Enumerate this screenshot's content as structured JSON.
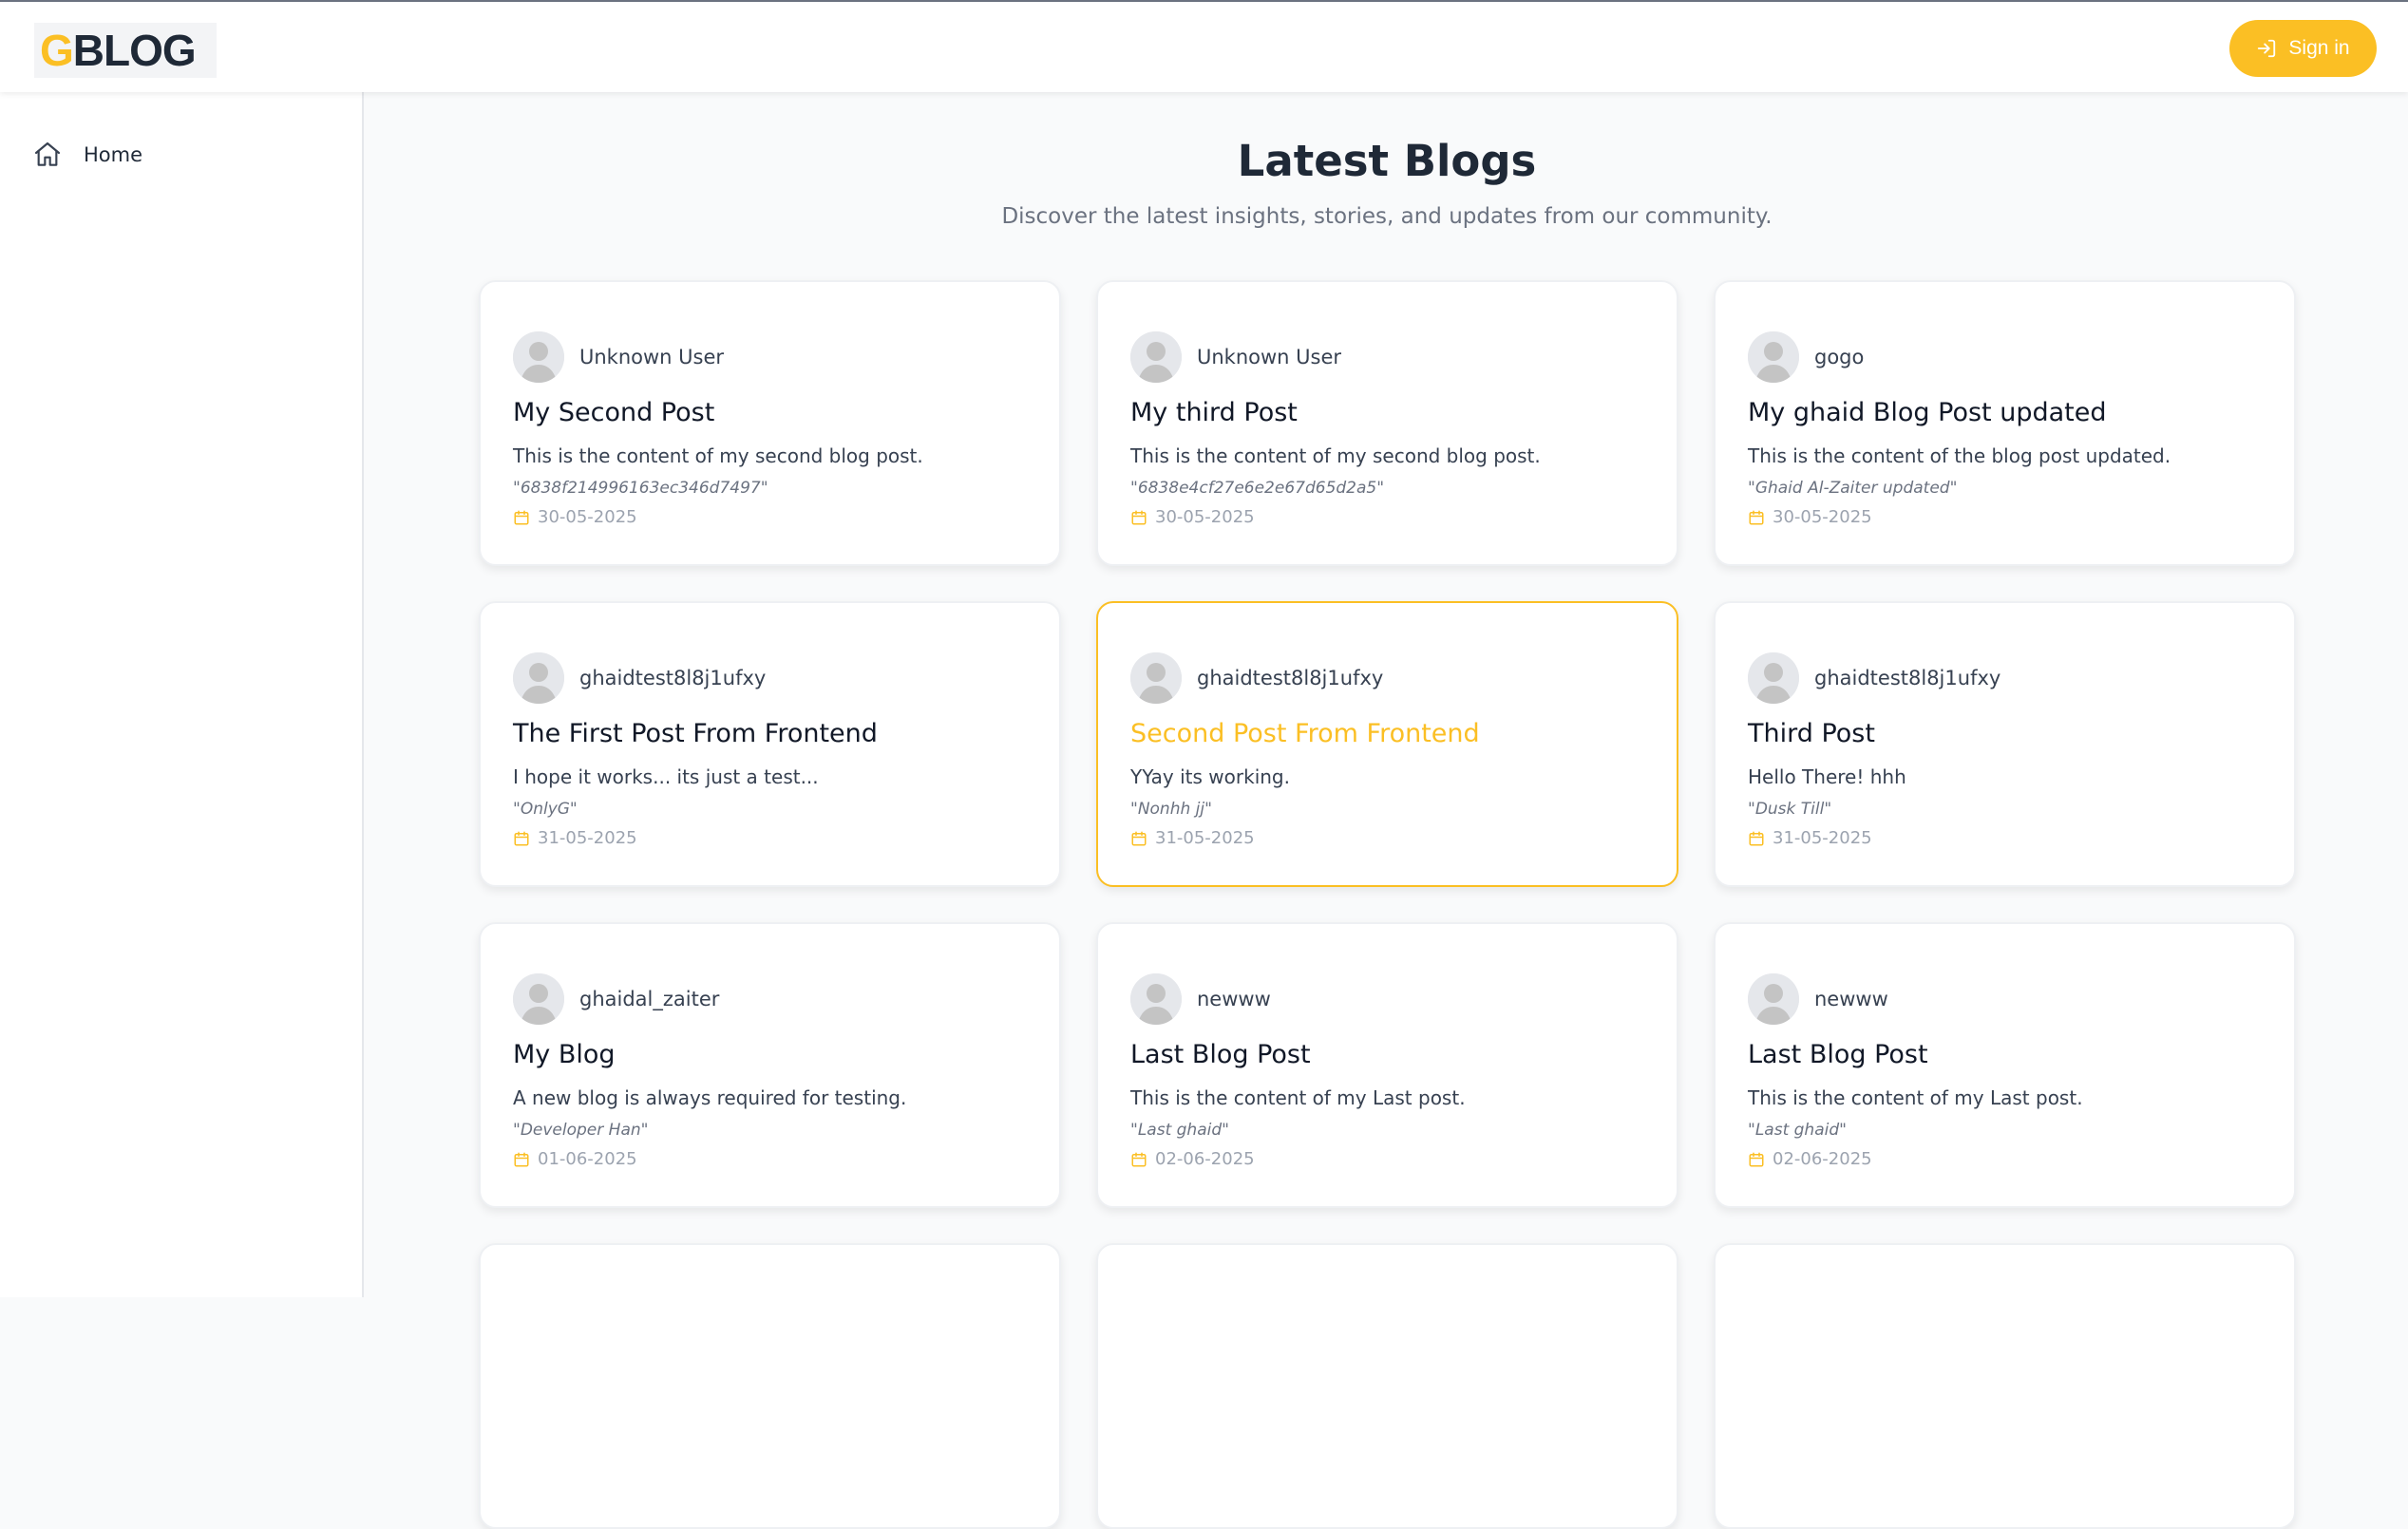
{
  "header": {
    "logo_g": "G",
    "logo_rest": "BLOG",
    "signin_label": "Sign in"
  },
  "sidebar": {
    "items": [
      {
        "label": "Home",
        "icon": "home-icon"
      }
    ]
  },
  "main": {
    "title": "Latest Blogs",
    "subtitle": "Discover the latest insights, stories, and updates from our community."
  },
  "colors": {
    "accent": "#fbbf24",
    "text": "#1f2937",
    "muted": "#6b7280"
  },
  "posts": [
    {
      "author": "Unknown User",
      "title": "My Second Post",
      "content": "This is the content of my second blog post.",
      "quote": "\"6838f214996163ec346d7497\"",
      "date": "30-05-2025"
    },
    {
      "author": "Unknown User",
      "title": "My third Post",
      "content": "This is the content of my second blog post.",
      "quote": "\"6838e4cf27e6e2e67d65d2a5\"",
      "date": "30-05-2025"
    },
    {
      "author": "gogo",
      "title": "My ghaid Blog Post updated",
      "content": "This is the content of the blog post updated.",
      "quote": "\"Ghaid Al-Zaiter updated\"",
      "date": "30-05-2025"
    },
    {
      "author": "ghaidtest8l8j1ufxy",
      "title": "The First Post From Frontend",
      "content": "I hope it works... its just a test...",
      "quote": "\"OnlyG\"",
      "date": "31-05-2025"
    },
    {
      "author": "ghaidtest8l8j1ufxy",
      "title": "Second Post From Frontend",
      "content": "YYay its working.",
      "quote": "\"Nonhh jj\"",
      "date": "31-05-2025",
      "active": true
    },
    {
      "author": "ghaidtest8l8j1ufxy",
      "title": "Third Post",
      "content": "Hello There! hhh",
      "quote": "\"Dusk Till\"",
      "date": "31-05-2025"
    },
    {
      "author": "ghaidal_zaiter",
      "title": "My Blog",
      "content": "A new blog is always required for testing.",
      "quote": "\"Developer Han\"",
      "date": "01-06-2025"
    },
    {
      "author": "newww",
      "title": "Last Blog Post",
      "content": "This is the content of my Last post.",
      "quote": "\"Last ghaid\"",
      "date": "02-06-2025"
    },
    {
      "author": "newww",
      "title": "Last Blog Post",
      "content": "This is the content of my Last post.",
      "quote": "\"Last ghaid\"",
      "date": "02-06-2025"
    },
    {
      "author": "",
      "title": "",
      "content": "",
      "quote": "",
      "date": ""
    },
    {
      "author": "",
      "title": "",
      "content": "",
      "quote": "",
      "date": ""
    },
    {
      "author": "",
      "title": "",
      "content": "",
      "quote": "",
      "date": ""
    }
  ]
}
